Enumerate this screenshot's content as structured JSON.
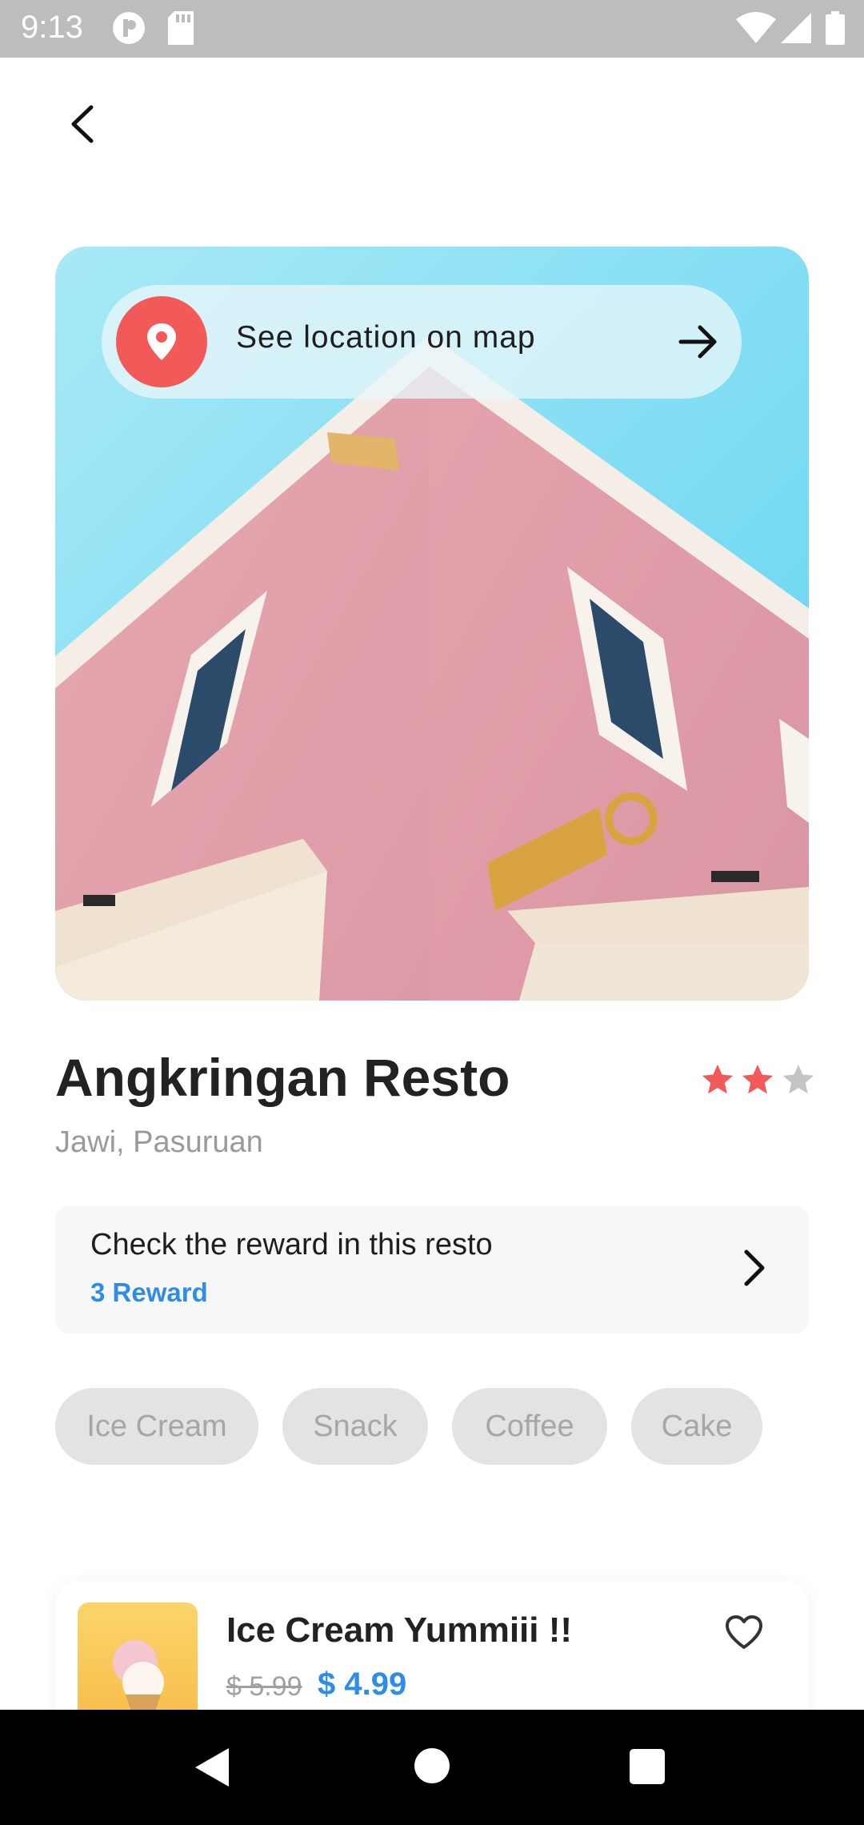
{
  "status_bar": {
    "time": "9:13",
    "icons": [
      "do-not-disturb-icon",
      "sd-card-icon",
      "wifi-icon",
      "cellular-icon",
      "battery-icon"
    ]
  },
  "header": {
    "back_icon": "chevron-left-icon"
  },
  "hero": {
    "location_label": "See location on map",
    "pin_icon": "location-pin-icon",
    "arrow_icon": "arrow-right-icon",
    "pin_color": "#f25a5a"
  },
  "restaurant": {
    "name": "Angkringan Resto",
    "location": "Jawi, Pasuruan",
    "rating": 2,
    "rating_max": 3,
    "star_color": "#f25a5a",
    "star_empty_color": "#c4c4c4"
  },
  "reward": {
    "title": "Check the reward in this resto",
    "count_label": "3 Reward",
    "accent": "#2e8de6"
  },
  "categories": [
    "Ice Cream",
    "Snack",
    "Coffee",
    "Cake"
  ],
  "products": [
    {
      "name": "Ice Cream Yummiii !!",
      "old_price": "$ 5.99",
      "price": "$ 4.99",
      "favorite_icon": "heart-outline-icon"
    }
  ],
  "nav_bar": {
    "back": "nav-back-icon",
    "home": "nav-home-icon",
    "recents": "nav-recents-icon"
  }
}
